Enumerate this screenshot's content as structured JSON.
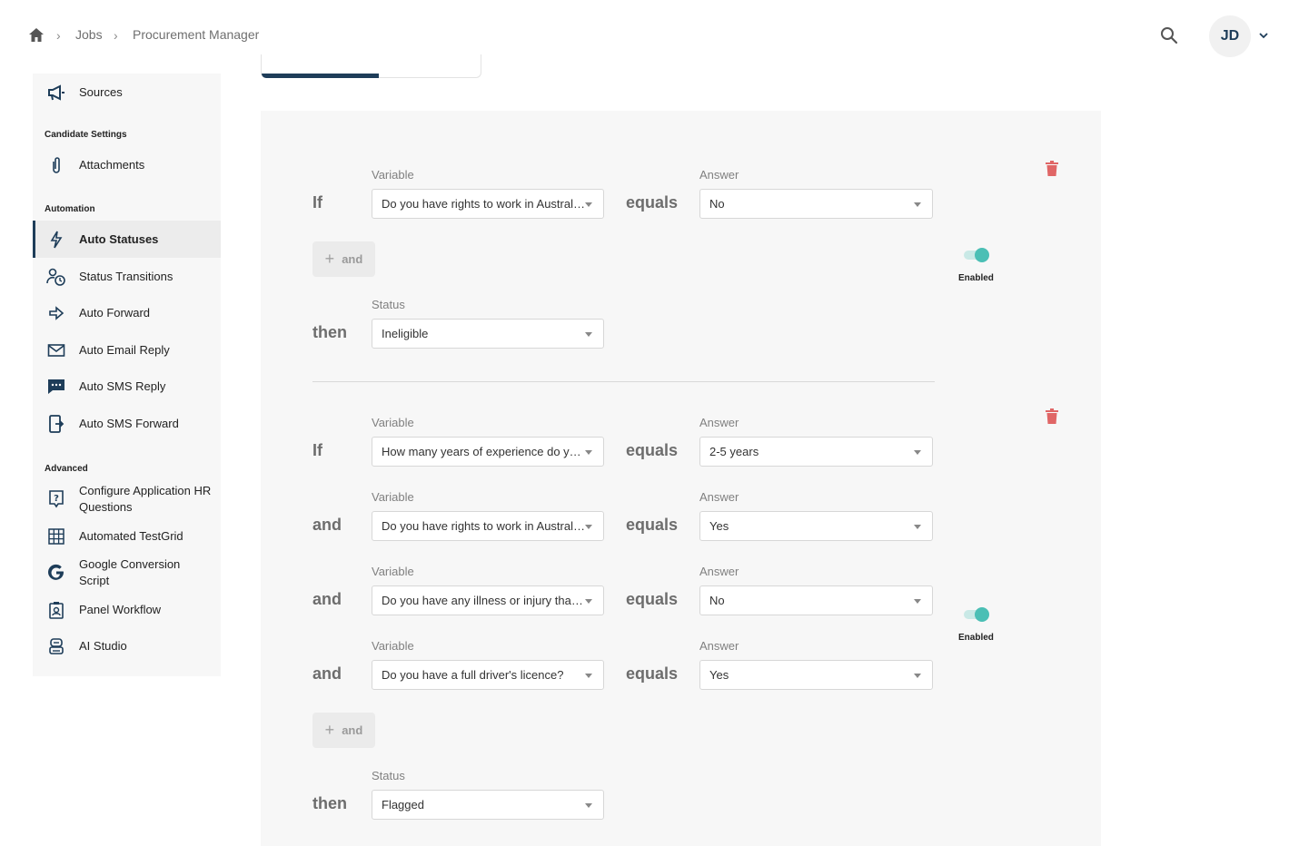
{
  "breadcrumb": {
    "items": [
      "Jobs",
      "Procurement Manager"
    ]
  },
  "user": {
    "initials": "JD"
  },
  "sidebar": {
    "top_item": "Sources",
    "sections": {
      "candidate_settings": "Candidate Settings",
      "automation": "Automation",
      "advanced": "Advanced"
    },
    "candidate_settings_items": [
      "Attachments"
    ],
    "automation_items": [
      "Auto Statuses",
      "Status Transitions",
      "Auto Forward",
      "Auto Email Reply",
      "Auto SMS Reply",
      "Auto SMS Forward"
    ],
    "advanced_items": [
      "Configure Application HR Questions",
      "Automated TestGrid",
      "Google Conversion Script",
      "Panel Workflow",
      "AI Studio"
    ]
  },
  "labels": {
    "if": "If",
    "and": "and",
    "then": "then",
    "equals": "equals",
    "variable": "Variable",
    "answer": "Answer",
    "status": "Status",
    "add_and": "and",
    "enabled": "Enabled"
  },
  "rules": [
    {
      "conditions": [
        {
          "variable": "Do you have rights to work in Australia?",
          "answer": "No"
        }
      ],
      "status": "Ineligible",
      "enabled": true
    },
    {
      "conditions": [
        {
          "variable": "How many years of experience do you have?",
          "answer": "2-5 years"
        },
        {
          "variable": "Do you have rights to work in Australia?",
          "answer": "Yes"
        },
        {
          "variable": "Do you have any illness or injury that may affect your work?",
          "answer": "No"
        },
        {
          "variable": "Do you have a full driver's licence?",
          "answer": "Yes"
        }
      ],
      "status": "Flagged",
      "enabled": true
    }
  ],
  "colors": {
    "accent": "#1e3d59",
    "toggle": "#4bbfb5",
    "trash": "#e06666"
  }
}
